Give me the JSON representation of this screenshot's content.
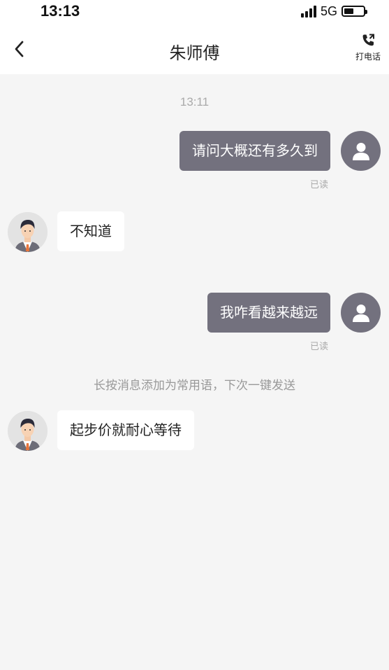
{
  "status_bar": {
    "time": "13:13",
    "network": "5G"
  },
  "header": {
    "title": "朱师傅",
    "call_label": "打电话"
  },
  "chat": {
    "timestamp": "13:11",
    "messages": [
      {
        "sender": "me",
        "text": "请问大概还有多久到",
        "status": "已读"
      },
      {
        "sender": "driver",
        "text": "不知道"
      },
      {
        "sender": "me",
        "text": "我咋看越来越远",
        "status": "已读"
      },
      {
        "sender": "driver",
        "text": "起步价就耐心等待"
      }
    ],
    "system_hint": "长按消息添加为常用语，下次一键发送"
  },
  "colors": {
    "my_bubble": "#73717e",
    "other_bubble": "#ffffff",
    "background": "#f5f5f5"
  }
}
